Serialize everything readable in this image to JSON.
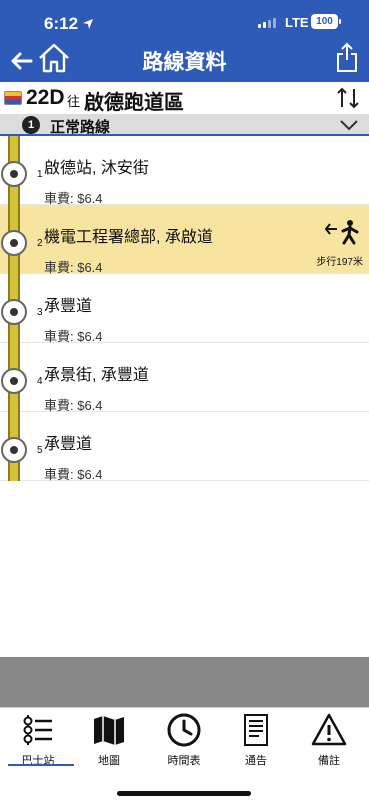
{
  "status": {
    "time": "6:12",
    "network": "LTE",
    "battery": "100"
  },
  "nav": {
    "title": "路線資料"
  },
  "route": {
    "number": "22D",
    "to_label": "往",
    "destination": "啟德跑道區"
  },
  "section": {
    "index": "1",
    "title": "正常路線"
  },
  "stops": [
    {
      "idx": "1",
      "name": "啟德站, 沐安街",
      "fare": "車費: $6.4"
    },
    {
      "idx": "2",
      "name": "機電工程署總部, 承啟道",
      "fare": "車費: $6.4",
      "highlight": true,
      "walk": "步行197米"
    },
    {
      "idx": "3",
      "name": "承豐道",
      "fare": "車費: $6.4"
    },
    {
      "idx": "4",
      "name": "承景街, 承豐道",
      "fare": "車費: $6.4"
    },
    {
      "idx": "5",
      "name": "承豐道",
      "fare": "車費: $6.4"
    }
  ],
  "tabs": [
    {
      "label": "巴士站",
      "icon": "bus-stop-icon"
    },
    {
      "label": "地圖",
      "icon": "map-icon"
    },
    {
      "label": "時間表",
      "icon": "clock-icon"
    },
    {
      "label": "通告",
      "icon": "notice-icon"
    },
    {
      "label": "備註",
      "icon": "warning-icon"
    }
  ],
  "colors": {
    "header": "#2f5bb8",
    "highlight": "#f6e4a0",
    "track": "#d4c23a"
  }
}
